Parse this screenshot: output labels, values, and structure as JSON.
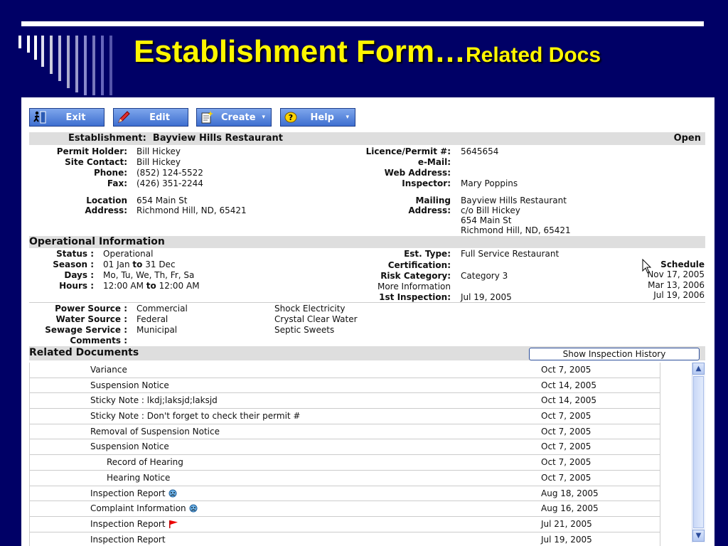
{
  "slide": {
    "title_main": "Establishment Form…",
    "title_sub": "Related Docs"
  },
  "toolbar": {
    "exit_label": "Exit",
    "edit_label": "Edit",
    "create_label": "Create",
    "help_label": "Help"
  },
  "establishment": {
    "label": "Establishment:",
    "name": "Bayview Hills Restaurant",
    "status": "Open",
    "permit_holder_label": "Permit Holder:",
    "permit_holder": "Bill Hickey",
    "site_contact_label": "Site Contact:",
    "site_contact": "Bill Hickey",
    "phone_label": "Phone:",
    "phone": "(852) 124-5522",
    "fax_label": "Fax:",
    "fax": "(426) 351-2244",
    "location_label_1": "Location",
    "location_label_2": "Address:",
    "location_line1": "654 Main St",
    "location_line2": "Richmond Hill, ND, 65421",
    "licence_label": "Licence/Permit #:",
    "licence": "5645654",
    "email_label": "e-Mail:",
    "web_label": "Web Address:",
    "inspector_label": "Inspector:",
    "inspector": "Mary Poppins",
    "mailing_label_1": "Mailing",
    "mailing_label_2": "Address:",
    "mailing_line1": "Bayview Hills Restaurant",
    "mailing_line2": "c/o Bill Hickey",
    "mailing_line3": "654 Main St",
    "mailing_line4": "Richmond Hill, ND, 65421"
  },
  "operational": {
    "header": "Operational Information",
    "status_label": "Status :",
    "status": "Operational",
    "season_label": "Season :",
    "season_from": "01 Jan",
    "season_to_word": "to",
    "season_to": "31 Dec",
    "days_label": "Days :",
    "days": "Mo, Tu, We, Th, Fr, Sa",
    "hours_label": "Hours :",
    "hours_from": "12:00 AM",
    "hours_to_word": "to",
    "hours_to": "12:00 AM",
    "est_type_label": "Est. Type:",
    "est_type": "Full Service Restaurant",
    "certification_label": "Certification:",
    "risk_label": "Risk Category:",
    "risk": "Category 3",
    "more_info": "More Information",
    "first_inspection_label": "1st Inspection:",
    "first_inspection": "Jul 19, 2005",
    "schedule_label": "Schedule",
    "schedule_dates": [
      "Nov 17, 2005",
      "Mar 13, 2006",
      "Jul 19, 2006"
    ],
    "power_label": "Power Source :",
    "power": "Commercial",
    "power_provider": "Shock Electricity",
    "water_label": "Water Source :",
    "water": "Federal",
    "water_provider": "Crystal Clear Water",
    "sewage_label": "Sewage Service :",
    "sewage": "Municipal",
    "sewage_provider": "Septic Sweets",
    "comments_label": "Comments :"
  },
  "related": {
    "header": "Related Documents",
    "show_history_label": "Show Inspection History",
    "rows": [
      {
        "name": "Variance",
        "date": "Oct 7, 2005",
        "indent": 0,
        "icon": ""
      },
      {
        "name": "Suspension Notice",
        "date": "Oct 14, 2005",
        "indent": 0,
        "icon": ""
      },
      {
        "name": "Sticky Note : lkdj;laksjd;laksjd",
        "date": "Oct 14, 2005",
        "indent": 0,
        "icon": ""
      },
      {
        "name": "Sticky Note : Don't forget to check their permit #",
        "date": "Oct 7, 2005",
        "indent": 0,
        "icon": ""
      },
      {
        "name": "Removal of Suspension Notice",
        "date": "Oct 7, 2005",
        "indent": 0,
        "icon": ""
      },
      {
        "name": "Suspension Notice",
        "date": "Oct 7, 2005",
        "indent": 0,
        "icon": ""
      },
      {
        "name": "Record of Hearing",
        "date": "Oct 7, 2005",
        "indent": 1,
        "icon": ""
      },
      {
        "name": "Hearing Notice",
        "date": "Oct 7, 2005",
        "indent": 1,
        "icon": ""
      },
      {
        "name": "Inspection Report",
        "date": "Aug 18, 2005",
        "indent": 0,
        "icon": "sad-face-icon"
      },
      {
        "name": "Complaint Information",
        "date": "Aug 16, 2005",
        "indent": 0,
        "icon": "sad-face-icon"
      },
      {
        "name": "Inspection Report",
        "date": "Jul 21, 2005",
        "indent": 0,
        "icon": "red-flag-icon"
      },
      {
        "name": "Inspection Report",
        "date": "Jul 19, 2005",
        "indent": 0,
        "icon": ""
      }
    ]
  },
  "colors": {
    "slide_background": "#000066",
    "title_yellow": "#fff600",
    "toolbar_blue": "#3e6fd0",
    "header_gray": "#dedede"
  }
}
